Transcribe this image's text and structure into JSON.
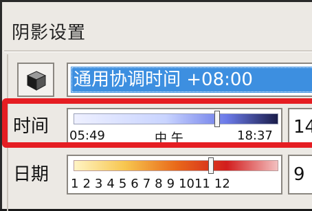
{
  "window": {
    "title": "阴影设置"
  },
  "timezone": {
    "icon": "cube-icon",
    "value": "通用协调时间 +08:00"
  },
  "time": {
    "label": "时间",
    "start": "05:49",
    "noon": "中 午",
    "end": "18:37",
    "value": "14",
    "position_fraction": 0.7
  },
  "date": {
    "label": "日期",
    "months": [
      "1",
      "2",
      "3",
      "4",
      "5",
      "6",
      "7",
      "8",
      "9",
      "10",
      "11",
      "12"
    ],
    "value": "9",
    "position_fraction": 0.67
  },
  "colors": {
    "highlight": "#e51d22",
    "selection": "#3d8fe0"
  }
}
